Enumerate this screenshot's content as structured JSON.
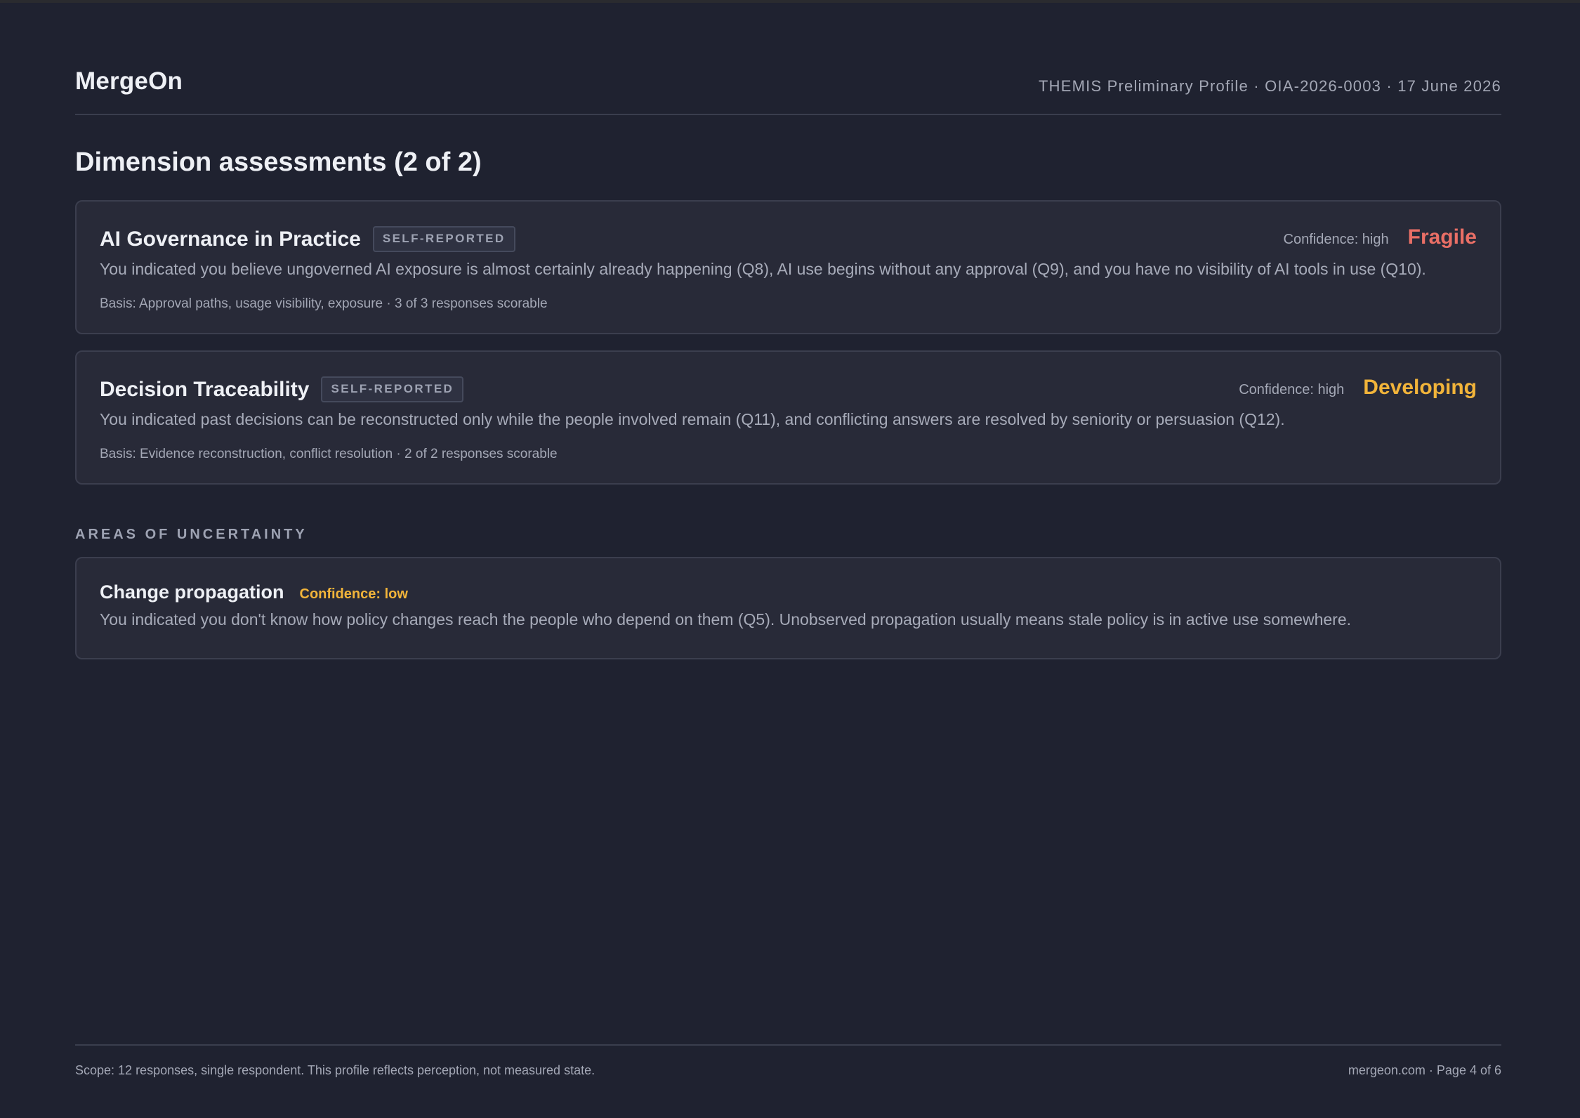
{
  "header": {
    "brand": "MergeOn",
    "meta": "THEMIS Preliminary Profile · OIA-2026-0003 · 17 June 2026"
  },
  "main": {
    "title": "Dimension assessments (2 of 2)",
    "dimensions": [
      {
        "title": "AI Governance in Practice",
        "badge": "SELF-REPORTED",
        "confidence": "Confidence: high",
        "rating": "Fragile",
        "rating_color": "#ea6f66",
        "description": "You indicated you believe ungoverned AI exposure is almost certainly already happening (Q8), AI use begins without any approval (Q9), and you have no visibility of AI tools in use (Q10).",
        "basis": "Basis: Approval paths, usage visibility, exposure · 3 of 3 responses scorable"
      },
      {
        "title": "Decision Traceability",
        "badge": "SELF-REPORTED",
        "confidence": "Confidence: high",
        "rating": "Developing",
        "rating_color": "#f2b43a",
        "description": "You indicated past decisions can be reconstructed only while the people involved remain (Q11), and conflicting answers are resolved by seniority or persuasion (Q12).",
        "basis": "Basis: Evidence reconstruction, conflict resolution · 2 of 2 responses scorable"
      }
    ],
    "uncertainty": {
      "heading": "AREAS OF UNCERTAINTY",
      "items": [
        {
          "title": "Change propagation",
          "confidence": "Confidence: low",
          "description": "You indicated you don't know how policy changes reach the people who depend on them (Q5). Unobserved propagation usually means stale policy is in active use somewhere."
        }
      ]
    }
  },
  "footer": {
    "scope": "Scope: 12 responses, single respondent. This profile reflects perception, not measured state.",
    "right": "mergeon.com · Page 4 of 6"
  }
}
